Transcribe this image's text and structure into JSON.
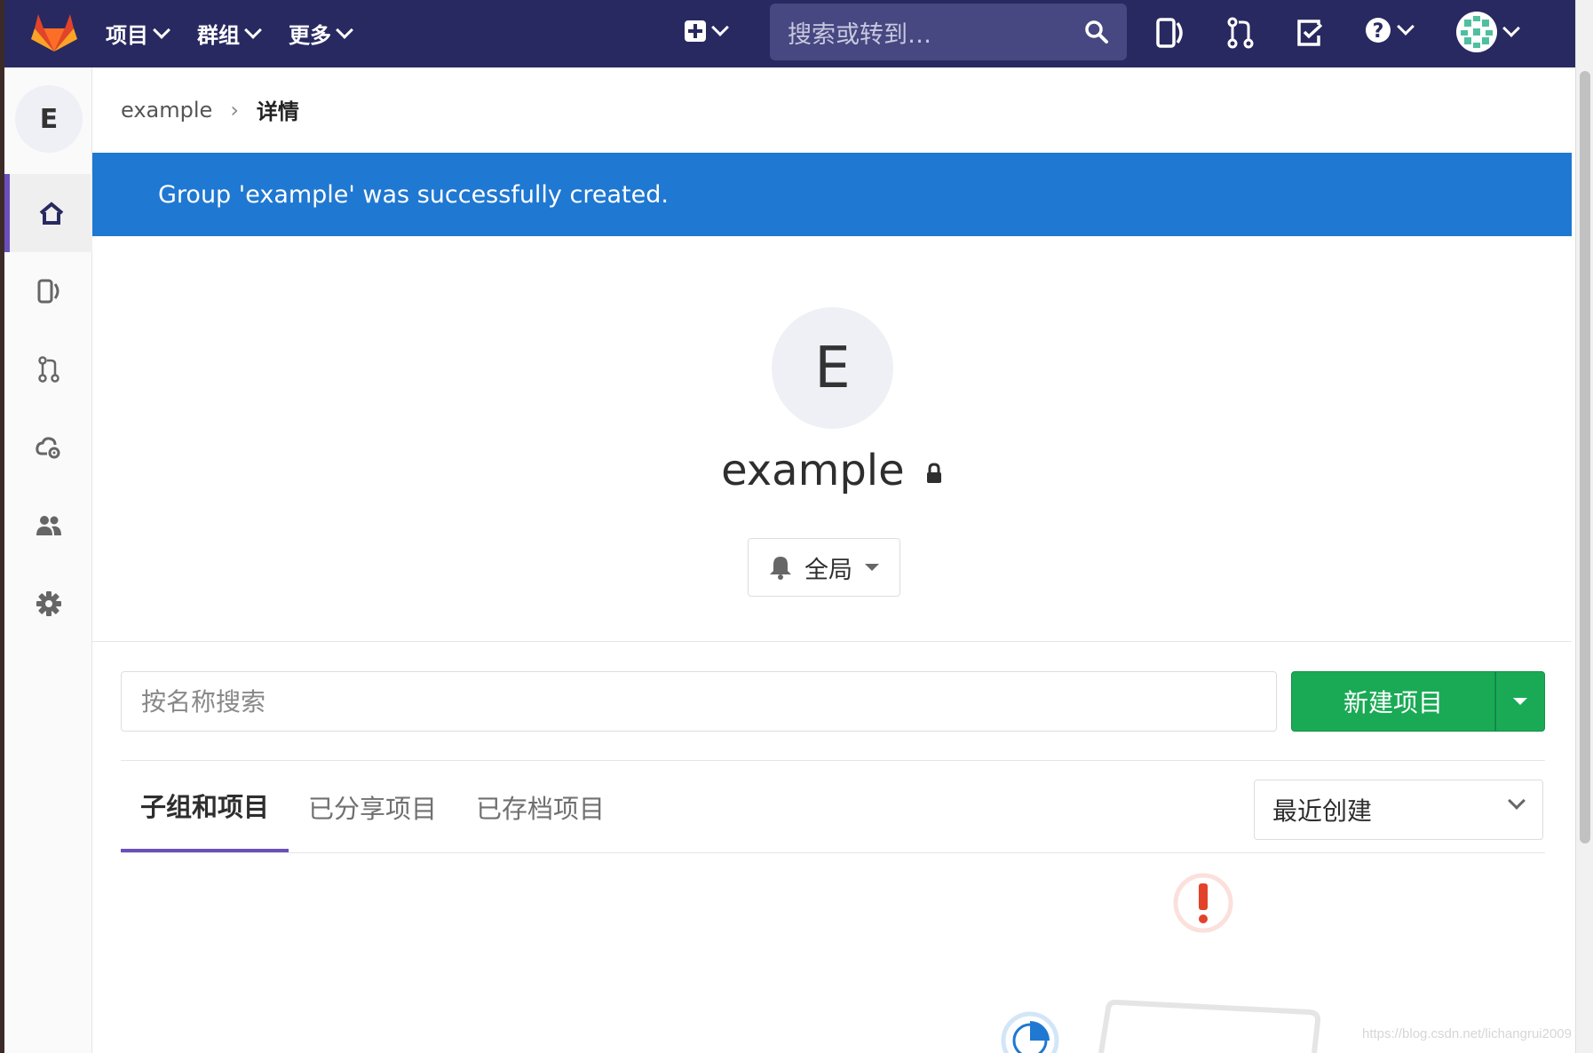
{
  "topbar": {
    "nav": [
      {
        "label": "项目"
      },
      {
        "label": "群组"
      },
      {
        "label": "更多"
      }
    ],
    "search_placeholder": "搜索或转到…"
  },
  "sidebar": {
    "group_initial": "E",
    "items": [
      {
        "icon": "home-icon",
        "active": true
      },
      {
        "icon": "issues-icon"
      },
      {
        "icon": "merge-request-icon"
      },
      {
        "icon": "kubernetes-icon"
      },
      {
        "icon": "members-icon"
      },
      {
        "icon": "settings-icon"
      }
    ]
  },
  "breadcrumb": {
    "group": "example",
    "current": "详情"
  },
  "flash": {
    "message": "Group 'example' was successfully created."
  },
  "group": {
    "initial": "E",
    "name": "example",
    "notification_level": "全局"
  },
  "filter": {
    "search_placeholder": "按名称搜索",
    "new_project_label": "新建项目"
  },
  "tabs": [
    {
      "label": "子组和项目",
      "active": true
    },
    {
      "label": "已分享项目"
    },
    {
      "label": "已存档项目"
    }
  ],
  "sort": {
    "selected": "最近创建"
  },
  "watermark": "https://blog.csdn.net/lichangrui2009",
  "colors": {
    "topbar": "#292961",
    "flash": "#1f78d1",
    "primary_green": "#1aaa55",
    "active_tab": "#6b4fbb"
  }
}
